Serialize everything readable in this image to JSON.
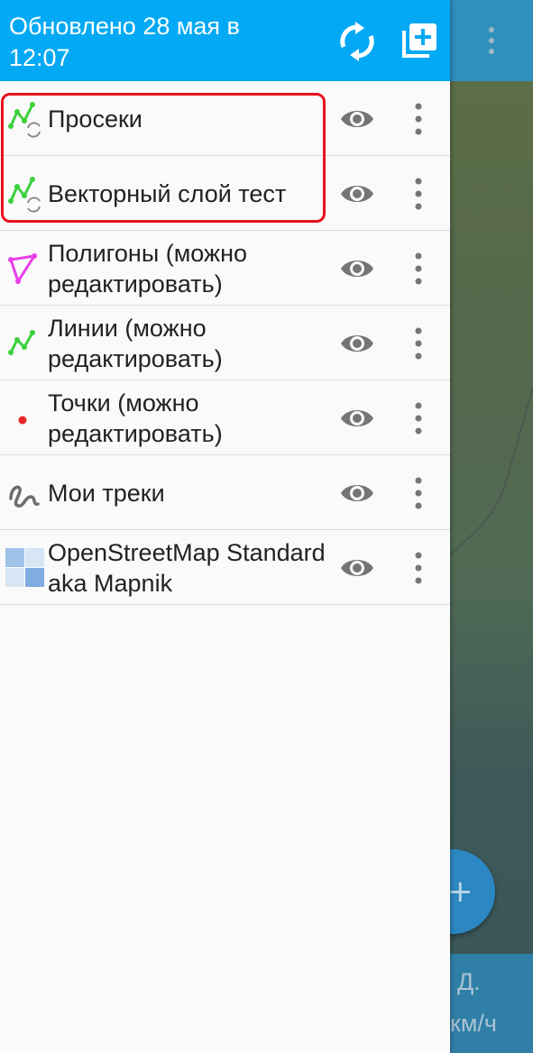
{
  "header": {
    "title_line1": "Обновлено 28 мая в",
    "title_line2": "12:07",
    "background": "#03a9f4",
    "refresh_icon": "sync-icon",
    "add_icon": "add-layer-icon"
  },
  "layers": [
    {
      "label": "Просеки",
      "icon": "synced-line-layer-icon",
      "visible": true
    },
    {
      "label": "Векторный слой тест",
      "icon": "synced-line-layer-icon",
      "visible": true
    },
    {
      "label": "Полигоны (можно редактировать)",
      "icon": "polygon-layer-icon",
      "visible": true
    },
    {
      "label": "Линии (можно редактировать)",
      "icon": "line-layer-icon",
      "visible": true
    },
    {
      "label": "Точки (можно редактировать)",
      "icon": "point-layer-icon",
      "visible": true
    },
    {
      "label": "Мои треки",
      "icon": "tracks-icon",
      "visible": true
    },
    {
      "label": "OpenStreetMap Standard aka Mapnik",
      "icon": "tile-layer-icon",
      "visible": true
    }
  ],
  "highlight": {
    "color": "#e8111c",
    "rows": [
      "Просеки",
      "Векторный слой тест"
    ]
  },
  "map_background": {
    "fab_label": "+",
    "status_line1": "Д.",
    "status_line2": "км/ч"
  }
}
